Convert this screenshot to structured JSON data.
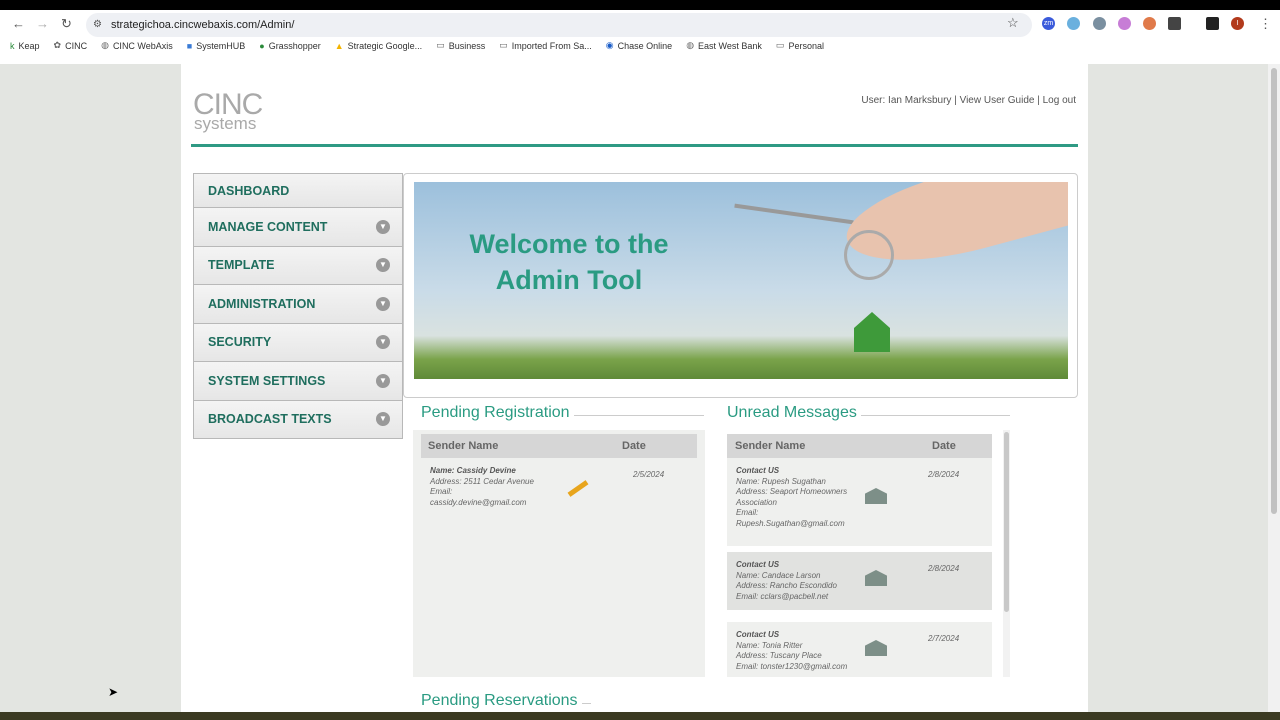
{
  "browser": {
    "url": "strategichoa.cincwebaxis.com/Admin/",
    "bookmarks": [
      "Keap",
      "CINC",
      "CINC WebAxis",
      "SystemHUB",
      "Grasshopper",
      "Strategic Google...",
      "Business",
      "Imported From Sa...",
      "Chase Online",
      "East West Bank",
      "Personal"
    ],
    "profile_initial": "I"
  },
  "header": {
    "logo_top": "CINC",
    "logo_bottom": "systems",
    "user": "User: Ian Marksbury",
    "guide": "View User Guide",
    "logout": "Log out",
    "sep": "|"
  },
  "menu": [
    "DASHBOARD",
    "MANAGE CONTENT",
    "TEMPLATE",
    "ADMINISTRATION",
    "SECURITY",
    "SYSTEM SETTINGS",
    "BROADCAST TEXTS"
  ],
  "banner": {
    "line1": "Welcome to the",
    "line2": "Admin Tool"
  },
  "pending_registration": {
    "title": "Pending Registration",
    "col_sender": "Sender Name",
    "col_date": "Date",
    "rows": [
      {
        "name": "Name: Cassidy Devine",
        "address": "Address: 2511 Cedar Avenue",
        "email_label": "Email:",
        "email": "cassidy.devine@gmail.com",
        "date": "2/5/2024"
      }
    ]
  },
  "unread_messages": {
    "title": "Unread Messages",
    "col_sender": "Sender Name",
    "col_date": "Date",
    "rows": [
      {
        "type": "Contact US",
        "name": "Name: Rupesh Sugathan",
        "address": "Address: Seaport Homeowners Association",
        "email": "Email: Rupesh.Sugathan@gmail.com",
        "date": "2/8/2024"
      },
      {
        "type": "Contact US",
        "name": "Name: Candace Larson",
        "address": "Address: Rancho Escondido",
        "email": "Email: cclars@pacbell.net",
        "date": "2/8/2024"
      },
      {
        "type": "Contact US",
        "name": "Name: Tonia Ritter",
        "address": "Address: Tuscany Place",
        "email": "Email: tonster1230@gmail.com",
        "date": "2/7/2024"
      }
    ]
  },
  "pending_reservations": {
    "title": "Pending Reservations"
  }
}
